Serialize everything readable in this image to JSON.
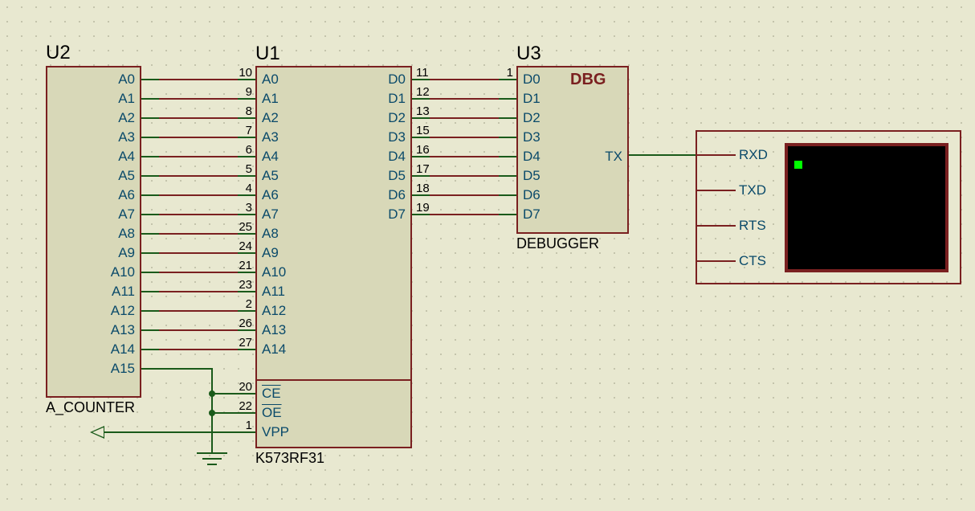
{
  "components": {
    "u2": {
      "ref": "U2",
      "name": "A_COUNTER",
      "pins_right": [
        "A0",
        "A1",
        "A2",
        "A3",
        "A4",
        "A5",
        "A6",
        "A7",
        "A8",
        "A9",
        "A10",
        "A11",
        "A12",
        "A13",
        "A14",
        "A15"
      ]
    },
    "u1": {
      "ref": "U1",
      "name": "K573RF31",
      "pins_left": [
        "A0",
        "A1",
        "A2",
        "A3",
        "A4",
        "A5",
        "A6",
        "A7",
        "A8",
        "A9",
        "A10",
        "A11",
        "A12",
        "A13",
        "A14"
      ],
      "pins_left_nums": [
        "10",
        "9",
        "8",
        "7",
        "6",
        "5",
        "4",
        "3",
        "25",
        "24",
        "21",
        "23",
        "2",
        "26",
        "27"
      ],
      "pins_ctrl": [
        "CE",
        "OE",
        "VPP"
      ],
      "pins_ctrl_nums": [
        "20",
        "22",
        "1"
      ],
      "pins_right": [
        "D0",
        "D1",
        "D2",
        "D3",
        "D4",
        "D5",
        "D6",
        "D7"
      ],
      "pins_right_nums": [
        "11",
        "12",
        "13",
        "15",
        "16",
        "17",
        "18",
        "19"
      ]
    },
    "u3": {
      "ref": "U3",
      "name": "DEBUGGER",
      "dbg": "DBG",
      "pins_left": [
        "D0",
        "D1",
        "D2",
        "D3",
        "D4",
        "D5",
        "D6",
        "D7"
      ],
      "pins_d0_num": "1",
      "pin_tx": "TX"
    },
    "term": {
      "pins": [
        "RXD",
        "TXD",
        "RTS",
        "CTS"
      ]
    }
  }
}
